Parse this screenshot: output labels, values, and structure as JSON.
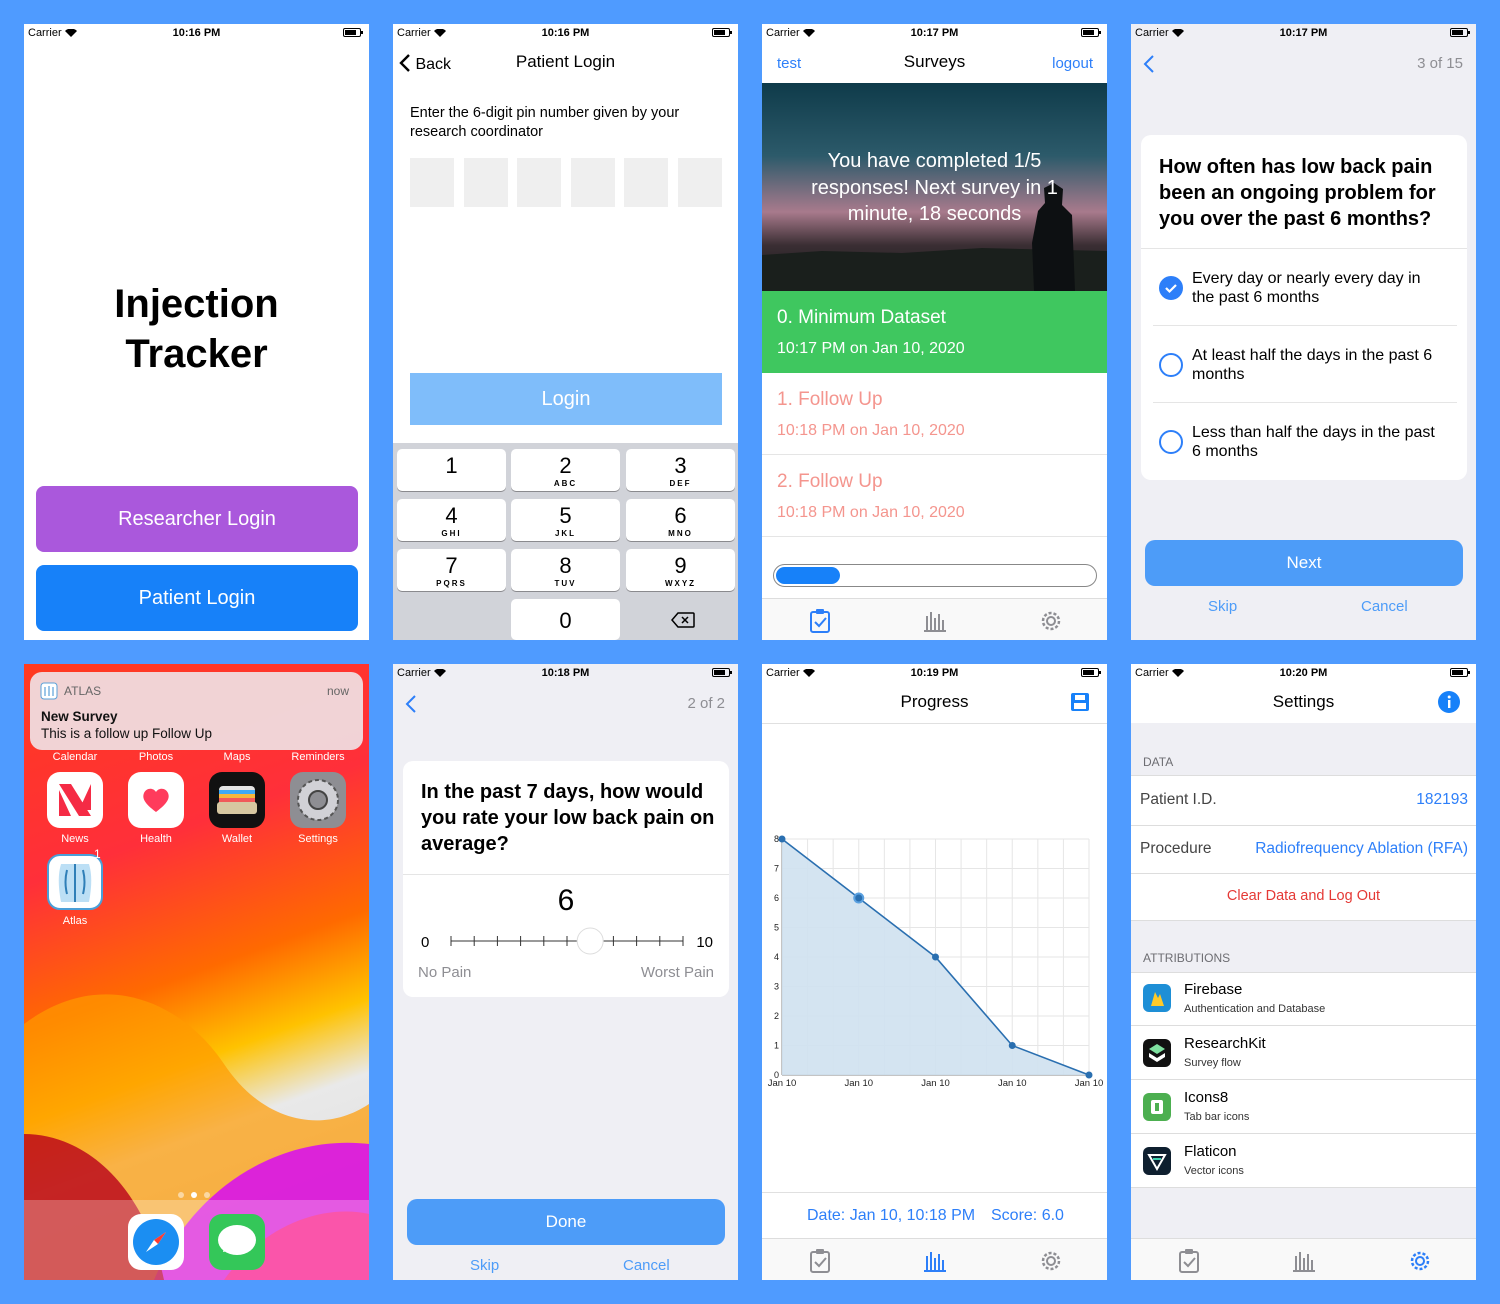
{
  "status": {
    "carrier": "Carrier"
  },
  "s1": {
    "time": "10:16 PM",
    "title_line1": "Injection",
    "title_line2": "Tracker",
    "researcher_btn": "Researcher Login",
    "patient_btn": "Patient Login"
  },
  "s2": {
    "time": "10:16 PM",
    "back": "Back",
    "title": "Patient Login",
    "instruction": "Enter the 6-digit pin number given by your research coordinator",
    "login_btn": "Login",
    "keys": [
      {
        "n": "1",
        "l": ""
      },
      {
        "n": "2",
        "l": "ABC"
      },
      {
        "n": "3",
        "l": "DEF"
      },
      {
        "n": "4",
        "l": "GHI"
      },
      {
        "n": "5",
        "l": "JKL"
      },
      {
        "n": "6",
        "l": "MNO"
      },
      {
        "n": "7",
        "l": "PQRS"
      },
      {
        "n": "8",
        "l": "TUV"
      },
      {
        "n": "9",
        "l": "WXYZ"
      },
      {
        "n": "0",
        "l": ""
      }
    ]
  },
  "s3": {
    "time": "10:17 PM",
    "left": "test",
    "title": "Surveys",
    "right": "logout",
    "banner": "You have completed 1/5 responses! Next survey in 1 minute, 18 seconds",
    "rows": [
      {
        "title": "0. Minimum Dataset",
        "date": "10:17 PM on Jan 10, 2020"
      },
      {
        "title": "1. Follow Up",
        "date": "10:18 PM on Jan 10, 2020"
      },
      {
        "title": "2. Follow Up",
        "date": "10:18 PM on Jan 10, 2020"
      }
    ],
    "progress": 0.2
  },
  "s4": {
    "time": "10:17 PM",
    "step": "3 of 15",
    "question": "How often has low back pain been an ongoing problem for you over the past 6 months?",
    "options": [
      {
        "text": "Every day or nearly every day in the past 6 months",
        "selected": true
      },
      {
        "text": "At least half the days in the past 6 months",
        "selected": false
      },
      {
        "text": "Less than half the days in the past 6 months",
        "selected": false
      }
    ],
    "next": "Next",
    "skip": "Skip",
    "cancel": "Cancel"
  },
  "s5": {
    "app": "ATLAS",
    "when": "now",
    "notif_title": "New Survey",
    "notif_body": "This is a follow up Follow Up",
    "top_labels": [
      "Calendar",
      "Photos",
      "Maps",
      "Reminders"
    ],
    "apps": [
      "News",
      "Health",
      "Wallet",
      "Settings"
    ],
    "atlas": "Atlas",
    "badge": "1"
  },
  "s6": {
    "time": "10:18 PM",
    "step": "2 of 2",
    "question": "In the past 7 days, how would you rate your low back pain on average?",
    "value": "6",
    "min": "0",
    "max": "10",
    "min_label": "No Pain",
    "max_label": "Worst Pain",
    "done": "Done",
    "skip": "Skip",
    "cancel": "Cancel"
  },
  "s7": {
    "time": "10:19 PM",
    "title": "Progress",
    "footer_date": "Date: Jan 10, 10:18 PM",
    "footer_score": "Score: 6.0"
  },
  "chart_data": {
    "type": "area",
    "x": [
      "Jan 10",
      "Jan 10",
      "Jan 10",
      "Jan 10",
      "Jan 10"
    ],
    "values": [
      8,
      6,
      4,
      1,
      0
    ],
    "ylim": [
      0,
      8
    ],
    "yticks": [
      "0",
      "1",
      "2",
      "3",
      "4",
      "5",
      "6",
      "7",
      "8"
    ],
    "grid": true
  },
  "s8": {
    "time": "10:20 PM",
    "title": "Settings",
    "data_header": "DATA",
    "pid_label": "Patient I.D.",
    "pid": "182193",
    "proc_label": "Procedure",
    "proc": "Radiofrequency Ablation (RFA)",
    "clear": "Clear Data and Log Out",
    "attr_header": "ATTRIBUTIONS",
    "attributions": [
      {
        "name": "Firebase",
        "desc": "Authentication and Database"
      },
      {
        "name": "ResearchKit",
        "desc": "Survey flow"
      },
      {
        "name": "Icons8",
        "desc": "Tab bar icons"
      },
      {
        "name": "Flaticon",
        "desc": "Vector icons"
      }
    ]
  }
}
